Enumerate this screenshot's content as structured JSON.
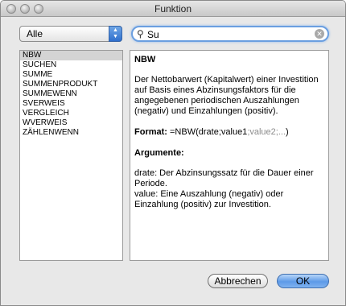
{
  "window": {
    "title": "Funktion"
  },
  "category": {
    "selected": "Alle"
  },
  "search": {
    "value": "Su"
  },
  "functions": [
    "NBW",
    "SUCHEN",
    "SUMME",
    "SUMMENPRODUKT",
    "SUMMEWENN",
    "SVERWEIS",
    "VERGLEICH",
    "WVERWEIS",
    "ZÄHLENWENN"
  ],
  "selected_function": "NBW",
  "description": {
    "title": "NBW",
    "body": "Der Nettobarwert (Kapitalwert) einer Investition auf Basis eines Abzinsungsfaktors für die angegebenen periodischen Auszahlungen (negativ) und Einzahlungen (positiv).",
    "format_label": "Format:",
    "format_main": " =NBW(drate;value1",
    "format_optional": ";value2;...",
    "format_close": ")",
    "arguments_title": "Argumente:",
    "arg1": "drate: Der Abzinsungssatz für die Dauer einer Periode.",
    "arg2": "value: Eine Auszahlung (negativ) oder Einzahlung (positiv) zur Investition."
  },
  "buttons": {
    "cancel": "Abbrechen",
    "ok": "OK"
  },
  "colors": {
    "accent": "#5d9ae8",
    "selection": "#d4d4d4",
    "optional_text": "#8c8c8c"
  }
}
